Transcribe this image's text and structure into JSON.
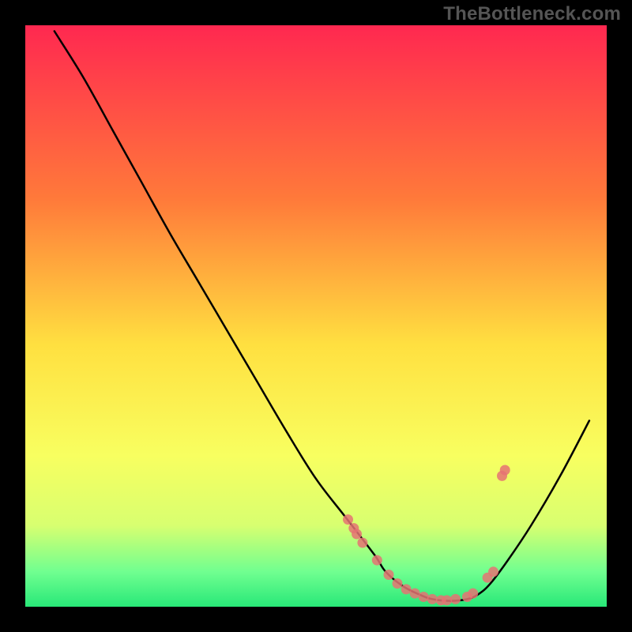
{
  "watermark": "TheBottleneck.com",
  "colors": {
    "background": "#000000",
    "gradient_top": "#ff2850",
    "gradient_mid_upper": "#ff7a3a",
    "gradient_mid": "#ffe040",
    "gradient_lower": "#f8ff60",
    "gradient_bottom1": "#d8ff70",
    "gradient_bottom2": "#70ff90",
    "gradient_bottom3": "#28e878",
    "curve": "#000000",
    "points": "#e57373"
  },
  "chart_data": {
    "type": "line",
    "title": "",
    "xlabel": "",
    "ylabel": "",
    "xlim": [
      0,
      100
    ],
    "ylim": [
      0,
      100
    ],
    "series": [
      {
        "name": "bottleneck-curve",
        "x": [
          5,
          10,
          15,
          20,
          25,
          30,
          35,
          40,
          45,
          50,
          55,
          60,
          62,
          65,
          68,
          70,
          73,
          76,
          78,
          80,
          83,
          87,
          92,
          97
        ],
        "y": [
          99,
          91,
          82,
          73,
          64,
          55.5,
          47,
          38.5,
          30,
          22,
          15.5,
          9,
          6,
          3.5,
          2,
          1.3,
          1,
          1.3,
          2.2,
          4,
          8,
          14,
          22.5,
          32
        ]
      }
    ],
    "scatter_points": {
      "name": "highlight-points",
      "x": [
        55.5,
        56.5,
        57,
        58,
        60.5,
        62.5,
        64,
        65.5,
        67,
        68.5,
        70,
        71.5,
        72.5,
        74,
        76,
        77,
        79.5,
        80.5,
        82,
        82.5
      ],
      "y": [
        15,
        13.5,
        12.5,
        11,
        8,
        5.5,
        4,
        3,
        2.3,
        1.7,
        1.3,
        1.1,
        1.1,
        1.3,
        1.7,
        2.3,
        5,
        6,
        22.5,
        23.5
      ]
    }
  }
}
